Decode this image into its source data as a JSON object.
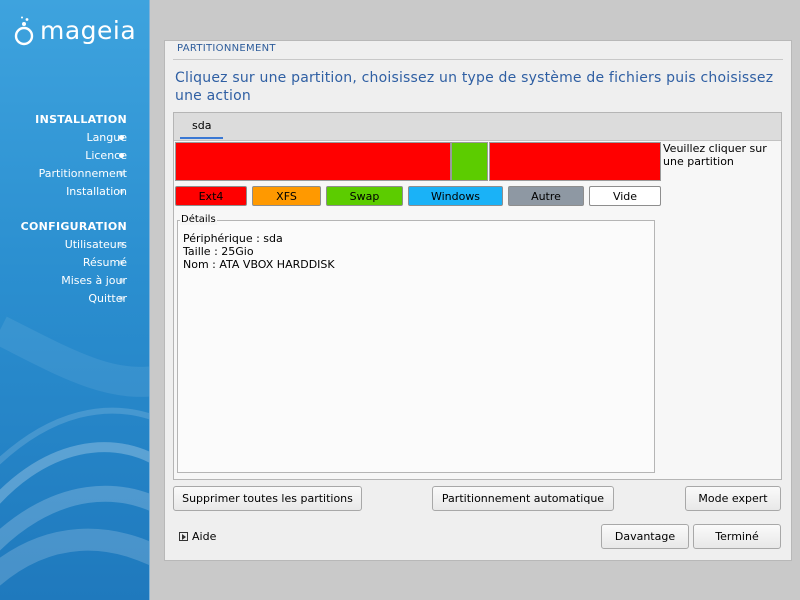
{
  "brand": {
    "logo_text": "mageia"
  },
  "sidebar": {
    "sections": [
      {
        "title": "INSTALLATION",
        "items": [
          {
            "label": "Langue",
            "done": true
          },
          {
            "label": "Licence",
            "done": true
          },
          {
            "label": "Partitionnement",
            "done": false
          },
          {
            "label": "Installation",
            "done": false
          }
        ]
      },
      {
        "title": "CONFIGURATION",
        "items": [
          {
            "label": "Utilisateurs",
            "done": false
          },
          {
            "label": "Résumé",
            "done": false
          },
          {
            "label": "Mises à jour",
            "done": false
          },
          {
            "label": "Quitter",
            "done": false
          }
        ]
      }
    ]
  },
  "main": {
    "step_label": "PARTITIONNEMENT",
    "heading": "Cliquez sur une partition, choisissez un type de système de fichiers puis choisissez une action",
    "tabs": [
      {
        "label": "sda"
      }
    ],
    "partition_hint": "Veuillez cliquer sur une partition",
    "partitions": [
      {
        "type": "Ext4",
        "color": "#ff0000"
      },
      {
        "type": "Swap",
        "color": "#5ccc00"
      },
      {
        "type": "Ext4",
        "color": "#ff0000"
      }
    ],
    "fs_types": [
      {
        "label": "Ext4",
        "color": "#ff0000"
      },
      {
        "label": "XFS",
        "color": "#ff9900"
      },
      {
        "label": "Swap",
        "color": "#5ccc00"
      },
      {
        "label": "Windows",
        "color": "#1ab2f7"
      },
      {
        "label": "Autre",
        "color": "#8e98a3"
      },
      {
        "label": "Vide",
        "color": "#ffffff"
      }
    ],
    "details": {
      "title": "Détails",
      "lines": [
        "Périphérique : sda",
        "Taille : 25Gio",
        "Nom : ATA VBOX HARDDISK"
      ]
    },
    "actions": {
      "delete_all": "Supprimer toutes les partitions",
      "auto": "Partitionnement automatique",
      "expert": "Mode expert"
    },
    "footer": {
      "help": "Aide",
      "more": "Davantage",
      "done": "Terminé"
    }
  }
}
